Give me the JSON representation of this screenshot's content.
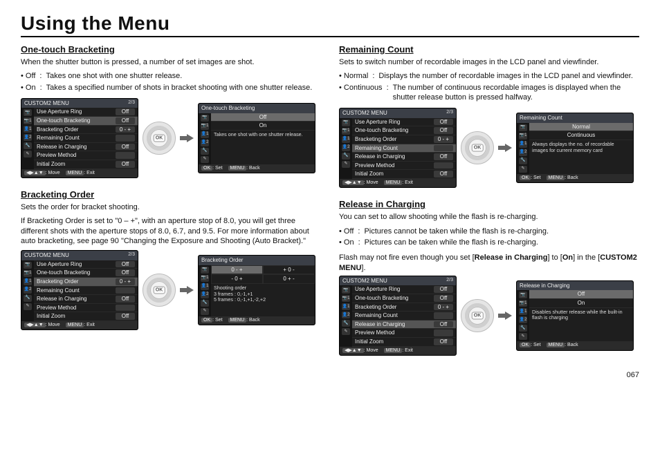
{
  "page_title": "Using the Menu",
  "page_number": "067",
  "menu_header": "CUSTOM2 MENU",
  "menu_page": "2/3",
  "menu_items": [
    {
      "label": "Use Aperture Ring",
      "value": "Off"
    },
    {
      "label": "One-touch Bracketing",
      "value": "Off"
    },
    {
      "label": "Bracketing Order",
      "value": "0 - +"
    },
    {
      "label": "Remaining Count",
      "value": ""
    },
    {
      "label": "Release in Charging",
      "value": "Off"
    },
    {
      "label": "Preview Method",
      "value": ""
    },
    {
      "label": "Initial Zoom",
      "value": "Off"
    }
  ],
  "side_icons": [
    "📷",
    "📷1",
    "👤1",
    "👤2",
    "🔧",
    "✎"
  ],
  "foot_main": {
    "k1": "◀▶▲▼",
    "l1": ": Move",
    "k2": "MENU",
    "l2": ": Exit"
  },
  "foot_detail": {
    "k1": "OK",
    "l1": ": Set",
    "k2": "MENU",
    "l2": ": Back"
  },
  "left": {
    "s1": {
      "title": "One-touch Bracketing",
      "intro": "When the shutter button is pressed, a number of set images are shot.",
      "bullets": [
        {
          "label": "• Off",
          "text": "Takes one shot with one shutter release."
        },
        {
          "label": "• On",
          "text": "Takes a specified number of shots in bracket shooting with one shutter release."
        }
      ],
      "detail_title": "One-touch Bracketing",
      "options": [
        "Off",
        "On"
      ],
      "option_sel": 0,
      "desc": "Takes one shot with one shutter release.",
      "menu_sel_idx": 1
    },
    "s2": {
      "title": "Bracketing Order",
      "intro": "Sets the order for bracket shooting.",
      "para": "If Bracketing Order is set to \"0 – +\", with an aperture stop of 8.0, you will get three different shots with the aperture stops of 8.0, 6.7, and 9.5. For more information about auto bracketing, see page 90 \"Changing the Exposure and Shooting (Auto Bracket).\"",
      "detail_title": "Bracketing Order",
      "grid": [
        "0 - +",
        "+ 0 -",
        "- 0 +",
        "0 + -"
      ],
      "grid_sel": 0,
      "desc": "Shooting order\n3 frames : 0,-1,+1\n5 frames : 0,-1,+1,-2,+2",
      "menu_sel_idx": 2
    }
  },
  "right": {
    "s1": {
      "title": "Remaining Count",
      "intro": "Sets to switch number of recordable images in the LCD panel and viewfinder.",
      "bullets": [
        {
          "label": "• Normal",
          "text": "Displays the number of recordable images in the LCD panel and viewfinder."
        },
        {
          "label": "• Continuous",
          "text": "The number of continuous recordable images is displayed when the shutter release button is pressed halfway."
        }
      ],
      "detail_title": "Remaining Count",
      "options": [
        "Normal",
        "Continuous"
      ],
      "option_sel": 0,
      "desc": "Always displays the no. of recordable images for current memory card",
      "menu_sel_idx": 3
    },
    "s2": {
      "title": "Release in Charging",
      "intro": "You can set to allow shooting while the flash is re-charging.",
      "bullets": [
        {
          "label": "• Off",
          "text": "Pictures cannot be taken while the flash is re-charging."
        },
        {
          "label": "• On",
          "text": "Pictures can be taken while the flash is re-charging."
        }
      ],
      "note_pre": "Flash may not fire even though you set [",
      "note_b1": "Release in Charging",
      "note_mid": "] to [",
      "note_b2": "On",
      "note_mid2": "] in the [",
      "note_b3": "CUSTOM2 MENU",
      "note_post": "].",
      "detail_title": "Release in Charging",
      "options": [
        "Off",
        "On"
      ],
      "option_sel": 0,
      "desc": "Disables shutter release while the built-in flash is charging",
      "menu_sel_idx": 4
    }
  }
}
